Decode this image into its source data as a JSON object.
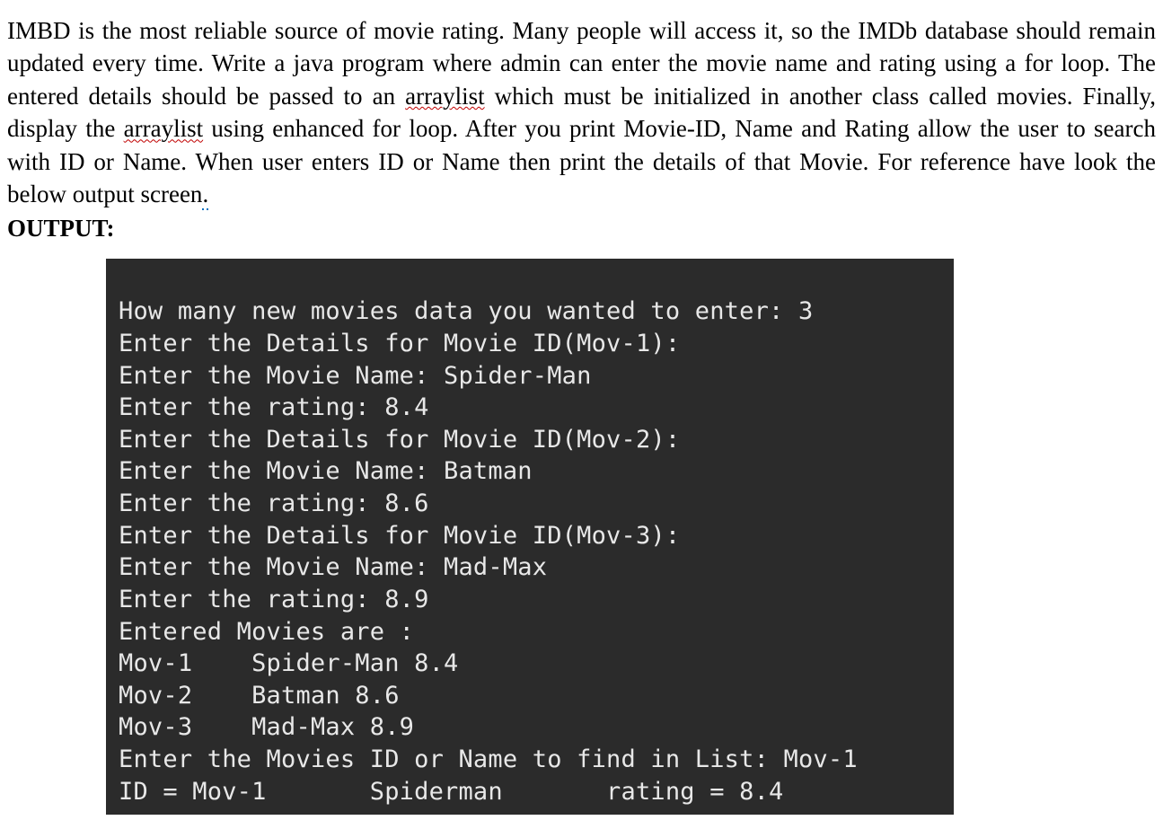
{
  "problem": {
    "p1_a": "IMBD is the most reliable source of movie rating. Many people will access it, so the IMDb database should remain updated every time. Write a java program where admin can enter the movie name and rating using a for loop. The entered details should be passed to an ",
    "p1_sq1": "arraylist",
    "p1_b": " which must be initialized in another class called movies. Finally, display the ",
    "p1_sq2": "arraylist",
    "p1_c": " using enhanced for loop. After you print Movie-ID, Name and Rating allow the user to search with ID or Name. When user enters ID or Name then print the details of that Movie. For reference have look the below output screen",
    "p1_dot": "."
  },
  "output_label": "OUTPUT:",
  "terminal": {
    "l1": "How many new movies data you wanted to enter: 3",
    "l2": "Enter the Details for Movie ID(Mov-1):",
    "l3": "Enter the Movie Name: Spider-Man",
    "l4": "Enter the rating: 8.4",
    "l5": "Enter the Details for Movie ID(Mov-2):",
    "l6": "Enter the Movie Name: Batman",
    "l7": "Enter the rating: 8.6",
    "l8": "Enter the Details for Movie ID(Mov-3):",
    "l9": "Enter the Movie Name: Mad-Max",
    "l10": "Enter the rating: 8.9",
    "l11": "Entered Movies are :",
    "l12": "Mov-1    Spider-Man 8.4",
    "l13": "Mov-2    Batman 8.6",
    "l14": "Mov-3    Mad-Max 8.9",
    "l15": "Enter the Movies ID or Name to find in List: Mov-1",
    "l16": "ID = Mov-1       Spiderman       rating = 8.4"
  }
}
